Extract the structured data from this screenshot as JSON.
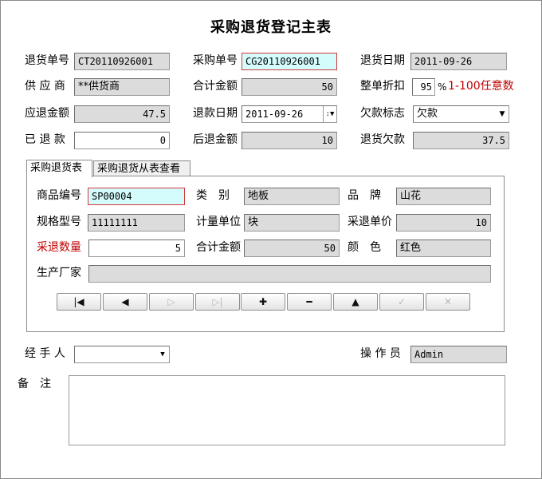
{
  "title": "采购退货登记主表",
  "header": {
    "return_no_label": "退货单号",
    "return_no": "CT20110926001",
    "purchase_no_label": "采购单号",
    "purchase_no": "CG20110926001",
    "return_date_label": "退货日期",
    "return_date": "2011-09-26",
    "supplier_label": "供 应 商",
    "supplier": "**供货商",
    "total_label": "合计金额",
    "total": "50",
    "discount_label": "整单折扣",
    "discount": "95",
    "discount_unit": "%",
    "discount_hint": "1-100任意数",
    "refund_due_label": "应退金额",
    "refund_due": "47.5",
    "refund_date_label": "退款日期",
    "refund_date": "2011-09-26",
    "debt_flag_label": "欠款标志",
    "debt_flag": "欠款",
    "refunded_label": "已 退 款",
    "refunded": "0",
    "after_amount_label": "后退金额",
    "after_amount": "10",
    "return_debt_label": "退货欠款",
    "return_debt": "37.5"
  },
  "tabs": [
    {
      "label": "采购退货表"
    },
    {
      "label": "采购退货从表查看"
    }
  ],
  "detail": {
    "code_label": "商品编号",
    "code": "SP00004",
    "category_label": "类　别",
    "category": "地板",
    "brand_label": "品　牌",
    "brand": "山花",
    "spec_label": "规格型号",
    "spec": "11111111",
    "unit_label": "计量单位",
    "unit": "块",
    "unit_price_label": "采退单价",
    "unit_price": "10",
    "qty_label": "采退数量",
    "qty": "5",
    "amount_label": "合计金额",
    "amount": "50",
    "color_label": "颜　色",
    "color": "红色",
    "maker_label": "生产厂家",
    "maker": ""
  },
  "nav_buttons": [
    {
      "name": "first-button",
      "glyph": "|◀",
      "enabled": true
    },
    {
      "name": "prev-button",
      "glyph": "◀",
      "enabled": true
    },
    {
      "name": "next-button",
      "glyph": "▷",
      "enabled": false
    },
    {
      "name": "last-button",
      "glyph": "▷|",
      "enabled": false
    },
    {
      "name": "add-button",
      "glyph": "✚",
      "enabled": true
    },
    {
      "name": "delete-button",
      "glyph": "━",
      "enabled": true
    },
    {
      "name": "edit-button",
      "glyph": "▲",
      "enabled": true
    },
    {
      "name": "confirm-button",
      "glyph": "✓",
      "enabled": false
    },
    {
      "name": "cancel-button",
      "glyph": "✕",
      "enabled": false
    }
  ],
  "footer": {
    "handler_label": "经 手 人",
    "handler": "",
    "operator_label": "操 作 员",
    "operator": "Admin",
    "memo_label": "备　注",
    "memo": ""
  }
}
